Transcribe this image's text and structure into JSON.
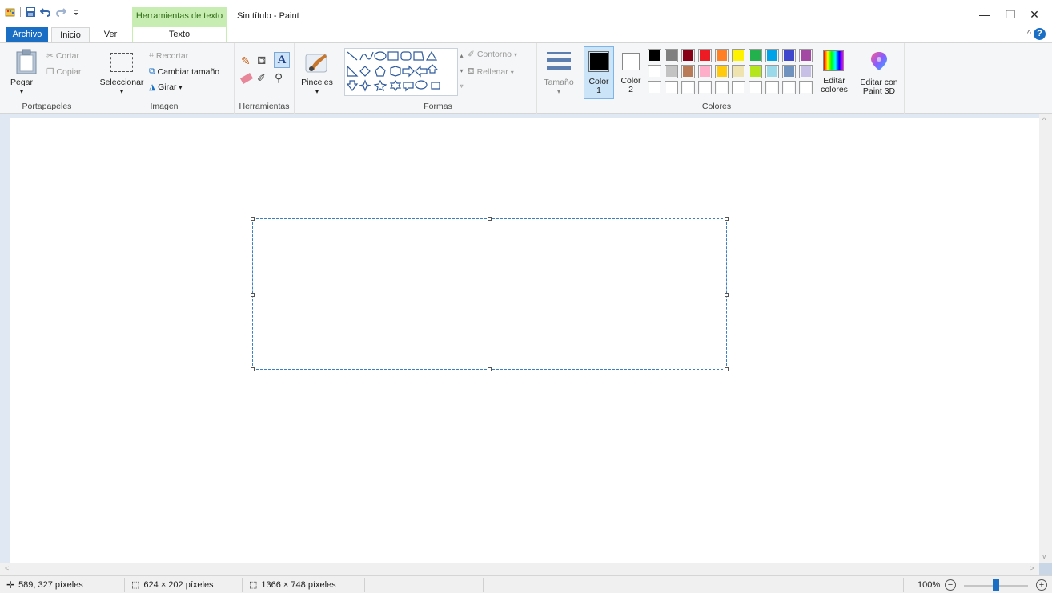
{
  "window": {
    "title": "Sin título - Paint",
    "context_tab_header": "Herramientas de texto",
    "controls": {
      "minimize": "—",
      "restore": "❐",
      "close": "✕"
    }
  },
  "tabs": {
    "archivo": "Archivo",
    "inicio": "Inicio",
    "ver": "Ver",
    "texto": "Texto"
  },
  "ribbon": {
    "portapapeles": {
      "label": "Portapapeles",
      "pegar": "Pegar",
      "cortar": "Cortar",
      "copiar": "Copiar"
    },
    "imagen": {
      "label": "Imagen",
      "seleccionar": "Seleccionar",
      "recortar": "Recortar",
      "cambiar_tamano": "Cambiar tamaño",
      "girar": "Girar"
    },
    "herramientas": {
      "label": "Herramientas"
    },
    "pinceles": {
      "label": "Pinceles"
    },
    "formas": {
      "label": "Formas",
      "contorno": "Contorno",
      "rellenar": "Rellenar"
    },
    "tamano": {
      "label": "Tamaño"
    },
    "colores": {
      "label": "Colores",
      "color1_line1": "Color",
      "color1_line2": "1",
      "color2_line1": "Color",
      "color2_line2": "2",
      "editar_colores_line1": "Editar",
      "editar_colores_line2": "colores",
      "color1_value": "#000000",
      "color2_value": "#ffffff",
      "palette_row1": [
        "#000000",
        "#7f7f7f",
        "#880015",
        "#ed1c24",
        "#ff7f27",
        "#fff200",
        "#22b14c",
        "#00a2e8",
        "#3f48cc",
        "#a349a4"
      ],
      "palette_row2": [
        "#ffffff",
        "#c3c3c3",
        "#b97a57",
        "#ffaec9",
        "#ffc90e",
        "#efe4b0",
        "#b5e61d",
        "#99d9ea",
        "#7092be",
        "#c8bfe7"
      ],
      "palette_row3": [
        "#ffffff",
        "#ffffff",
        "#ffffff",
        "#ffffff",
        "#ffffff",
        "#ffffff",
        "#ffffff",
        "#ffffff",
        "#ffffff",
        "#ffffff"
      ]
    },
    "paint3d": {
      "line1": "Editar con",
      "line2": "Paint 3D"
    }
  },
  "status": {
    "cursor_position": "589, 327 píxeles",
    "selection_size": "624 × 202 píxeles",
    "image_size": "1366 × 748 píxeles",
    "zoom": "100%"
  }
}
